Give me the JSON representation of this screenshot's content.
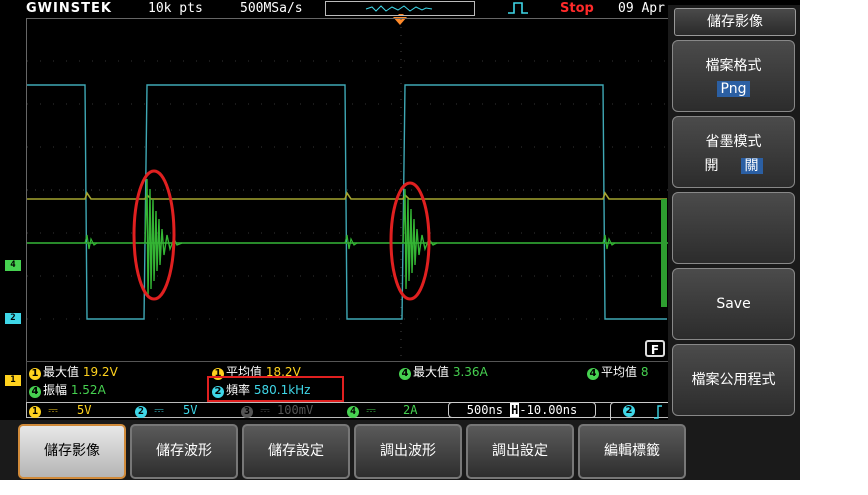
{
  "topbar": {
    "logo": "GWINSTEK",
    "points": "10k pts",
    "sample_rate": "500MSa/s",
    "status": "Stop",
    "date": "09 Apr"
  },
  "markers": {
    "ch4": "4",
    "ch2": "2",
    "ch1": "1",
    "f_icon": "F"
  },
  "measurements": {
    "row1": [
      {
        "ch": "1",
        "label": "最大值",
        "value": "19.2V",
        "color": "#ffd21e"
      },
      {
        "ch": "1",
        "label": "平均值",
        "value": "18.2V",
        "color": "#ffd21e"
      },
      {
        "ch": "4",
        "label": "最大值",
        "value": "3.36A",
        "color": "#46d150"
      },
      {
        "ch": "4",
        "label": "平均值",
        "value": "8",
        "color": "#46d150"
      }
    ],
    "row2": [
      {
        "ch": "4",
        "label": "振幅",
        "value": "1.52A",
        "color": "#46d150"
      },
      {
        "ch": "2",
        "label": "頻率",
        "value": "580.1kHz",
        "color": "#3fd7e8"
      }
    ]
  },
  "channel_bar": {
    "ch1": {
      "num": "1",
      "coupling": "⎓",
      "scale": "5V"
    },
    "ch2": {
      "num": "2",
      "coupling": "⎓",
      "scale": "5V"
    },
    "ch3": {
      "num": "3",
      "coupling": "⎓",
      "scale": "100mV"
    },
    "ch4": {
      "num": "4",
      "coupling": "⎓",
      "scale": "2A"
    }
  },
  "timebase": {
    "scale": "500ns",
    "position_icon": "H",
    "position": "-10.00ns"
  },
  "trigger": {
    "source": "2",
    "slope_icon": "rising-edge-icon"
  },
  "side_menu": {
    "title": "儲存影像",
    "file_format": {
      "label": "檔案格式",
      "value": "Png"
    },
    "ink_saver": {
      "label": "省墨模式",
      "on": "開",
      "off": "關"
    },
    "save": "Save",
    "file_utilities": "檔案公用程式"
  },
  "bottom_menu": [
    {
      "label": "儲存影像",
      "active": true
    },
    {
      "label": "儲存波形",
      "active": false
    },
    {
      "label": "儲存設定",
      "active": false
    },
    {
      "label": "調出波形",
      "active": false
    },
    {
      "label": "調出設定",
      "active": false
    },
    {
      "label": "編輯標籤",
      "active": false
    }
  ],
  "colors": {
    "ch1": "#ffd21e",
    "ch2": "#3fd7e8",
    "ch4": "#46d150",
    "stop": "#ff2a2a",
    "annotation": "#e02020"
  }
}
